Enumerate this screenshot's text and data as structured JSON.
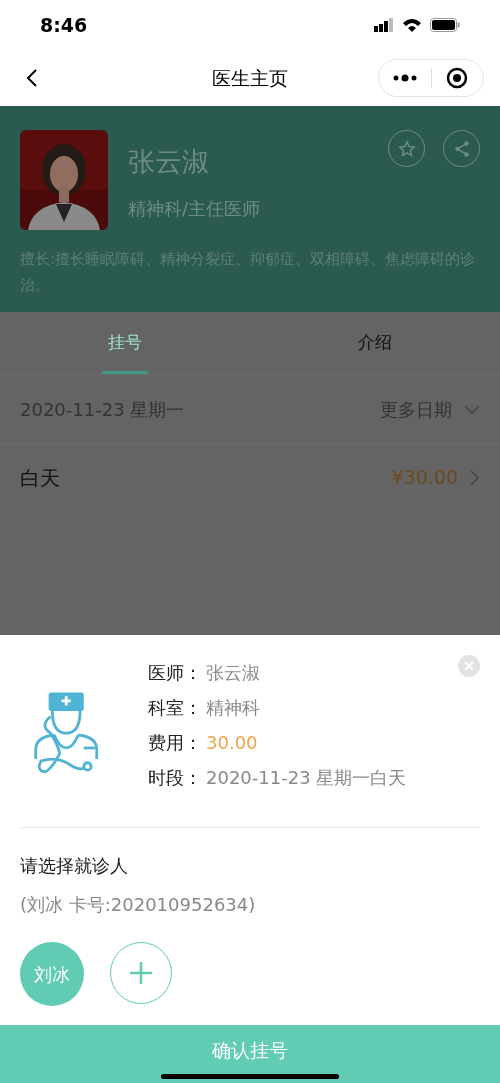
{
  "status_bar": {
    "time": "8:46"
  },
  "nav": {
    "title": "医生主页"
  },
  "doctor": {
    "name": "张云淑",
    "title": "精神科/主任医师",
    "specialty": "擅长:擅长睡眠障碍、精神分裂症、抑郁症、双相障碍、焦虑障碍的诊治。"
  },
  "tabs": [
    {
      "label": "挂号",
      "selected": true
    },
    {
      "label": "介绍",
      "selected": false
    }
  ],
  "date_row": {
    "date": "2020-11-23 星期一",
    "more": "更多日期"
  },
  "slots": [
    {
      "label": "白天",
      "price": "¥30.00"
    }
  ],
  "sheet": {
    "details": [
      {
        "label": "医师：",
        "value": "张云淑",
        "kind": "plain"
      },
      {
        "label": "科室：",
        "value": "精神科",
        "kind": "plain"
      },
      {
        "label": "费用：",
        "value": "30.00",
        "kind": "price"
      },
      {
        "label": "时段：",
        "value": "2020-11-23 星期一白天",
        "kind": "plain"
      }
    ],
    "prompt": "请选择就诊人",
    "patient_info": "(刘冰 卡号:202010952634)",
    "patients": [
      {
        "name": "刘冰",
        "selected": true
      }
    ]
  },
  "confirm_button": "确认挂号"
}
